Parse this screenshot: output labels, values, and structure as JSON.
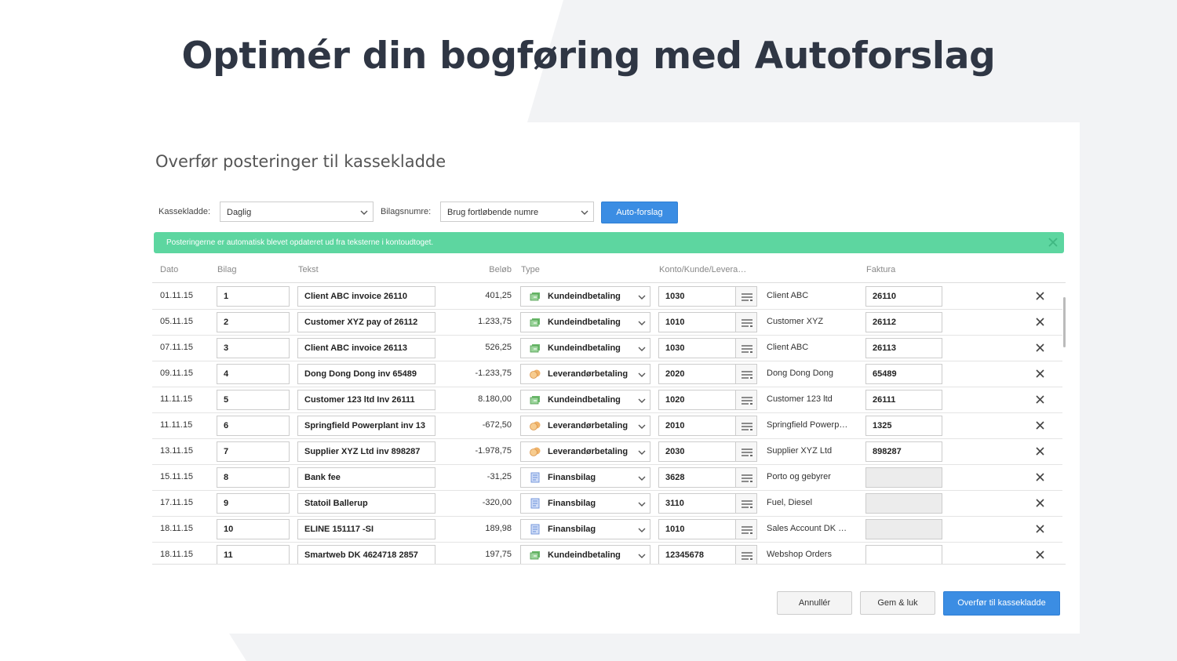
{
  "slide_title": "Optimér din bogføring med Autoforslag",
  "dialog": {
    "title": "Overfør posteringer til kassekladde",
    "kassekladde_label": "Kassekladde:",
    "kassekladde_value": "Daglig",
    "bilagsnumre_label": "Bilagsnumre:",
    "bilagsnumre_value": "Brug fortløbende numre",
    "auto_button": "Auto-forslag",
    "alert_text": "Posteringerne er automatisk blevet opdateret ud fra teksterne i kontoudtoget.",
    "columns": {
      "dato": "Dato",
      "bilag": "Bilag",
      "tekst": "Tekst",
      "belob": "Beløb",
      "type": "Type",
      "konto": "Konto/Kunde/Levera…",
      "faktura": "Faktura"
    },
    "rows": [
      {
        "dato": "01.11.15",
        "bilag": "1",
        "tekst": "Client ABC invoice 26110",
        "belob": "401,25",
        "type": "Kundeindbetaling",
        "konto": "1030",
        "navn": "Client ABC",
        "faktura": "26110"
      },
      {
        "dato": "05.11.15",
        "bilag": "2",
        "tekst": "Customer XYZ pay of  26112",
        "belob": "1.233,75",
        "type": "Kundeindbetaling",
        "konto": "1010",
        "navn": "Customer XYZ",
        "faktura": "26112"
      },
      {
        "dato": "07.11.15",
        "bilag": "3",
        "tekst": "Client ABC invoice 26113",
        "belob": "526,25",
        "type": "Kundeindbetaling",
        "konto": "1030",
        "navn": "Client ABC",
        "faktura": "26113"
      },
      {
        "dato": "09.11.15",
        "bilag": "4",
        "tekst": "Dong Dong Dong inv 65489",
        "belob": "-1.233,75",
        "type": "Leverandørbetaling",
        "konto": "2020",
        "navn": "Dong Dong Dong",
        "faktura": "65489"
      },
      {
        "dato": "11.11.15",
        "bilag": "5",
        "tekst": "Customer 123 ltd Inv 26111",
        "belob": "8.180,00",
        "type": "Kundeindbetaling",
        "konto": "1020",
        "navn": "Customer 123 ltd",
        "faktura": "26111"
      },
      {
        "dato": "11.11.15",
        "bilag": "6",
        "tekst": "Springfield Powerplant inv 13",
        "belob": "-672,50",
        "type": "Leverandørbetaling",
        "konto": "2010",
        "navn": "Springfield Powerp…",
        "faktura": "1325"
      },
      {
        "dato": "13.11.15",
        "bilag": "7",
        "tekst": "Supplier XYZ Ltd inv 898287",
        "belob": "-1.978,75",
        "type": "Leverandørbetaling",
        "konto": "2030",
        "navn": "Supplier XYZ Ltd",
        "faktura": "898287"
      },
      {
        "dato": "15.11.15",
        "bilag": "8",
        "tekst": "Bank fee",
        "belob": "-31,25",
        "type": "Finansbilag",
        "konto": "3628",
        "navn": "Porto og gebyrer",
        "faktura": ""
      },
      {
        "dato": "17.11.15",
        "bilag": "9",
        "tekst": "Statoil Ballerup",
        "belob": "-320,00",
        "type": "Finansbilag",
        "konto": "3110",
        "navn": "Fuel, Diesel",
        "faktura": ""
      },
      {
        "dato": "18.11.15",
        "bilag": "10",
        "tekst": "ELINE 151117            -SI",
        "belob": "189,98",
        "type": "Finansbilag",
        "konto": "1010",
        "navn": "Sales Account DK …",
        "faktura": ""
      },
      {
        "dato": "18.11.15",
        "bilag": "11",
        "tekst": "Smartweb DK  4624718 2857",
        "belob": "197,75",
        "type": "Kundeindbetaling",
        "konto": "12345678",
        "navn": "Webshop Orders",
        "faktura": ""
      }
    ],
    "cancel_button": "Annullér",
    "save_button": "Gem & luk",
    "transfer_button": "Overfør til kassekladde"
  }
}
